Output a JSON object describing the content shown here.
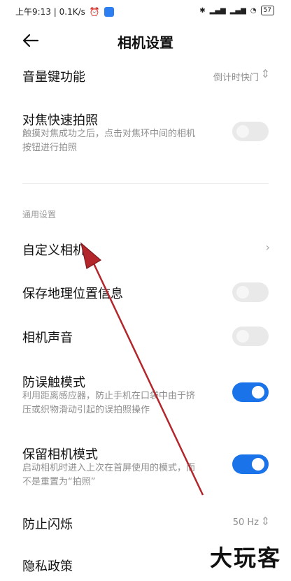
{
  "status_bar": {
    "time": "上午9:13 | 0.1K/s",
    "battery": "57"
  },
  "header": {
    "title": "相机设置"
  },
  "settings": {
    "volume_key": {
      "label": "音量键功能",
      "value": "倒计时快门"
    },
    "focus_shoot": {
      "label": "对焦快速拍照",
      "desc1": "触摸对焦成功之后，点击对焦环中间的相机",
      "desc2": "按钮进行拍照",
      "enabled": false
    },
    "section_general": "通用设置",
    "custom_camera": {
      "label": "自定义相机"
    },
    "save_location": {
      "label": "保存地理位置信息",
      "enabled": false
    },
    "camera_sound": {
      "label": "相机声音",
      "enabled": false
    },
    "anti_touch": {
      "label": "防误触模式",
      "desc1": "利用距离感应器，防止手机在口袋中由于挤",
      "desc2": "压或织物滑动引起的误拍照操作",
      "enabled": true
    },
    "keep_mode": {
      "label": "保留相机模式",
      "desc1": "启动相机时进入上次在首屏使用的模式，而",
      "desc2": "不是重置为“拍照”",
      "enabled": true
    },
    "anti_flicker": {
      "label": "防止闪烁",
      "value": "50 Hz"
    },
    "privacy": {
      "label": "隐私政策"
    }
  },
  "watermark": "大玩客",
  "colors": {
    "toggle_on": "#1a73e8",
    "annotation_arrow": "#b3262b"
  }
}
